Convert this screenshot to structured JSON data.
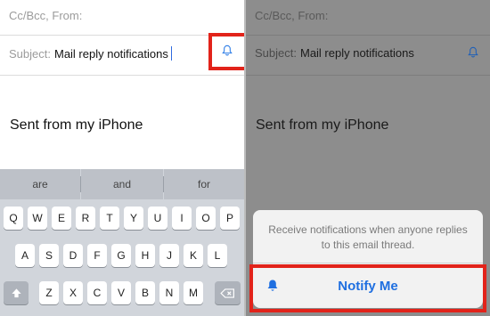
{
  "compose": {
    "cc_from_label": "Cc/Bcc, From:",
    "subject_label": "Subject:",
    "subject_value": "Mail reply notifications",
    "signature": "Sent from my iPhone"
  },
  "keyboard": {
    "suggestions": [
      "are",
      "and",
      "for"
    ],
    "row1": [
      "Q",
      "W",
      "E",
      "R",
      "T",
      "Y",
      "U",
      "I",
      "O",
      "P"
    ],
    "row2": [
      "A",
      "S",
      "D",
      "F",
      "G",
      "H",
      "J",
      "K",
      "L"
    ],
    "row3": [
      "Z",
      "X",
      "C",
      "V",
      "B",
      "N",
      "M"
    ]
  },
  "notify_sheet": {
    "message": "Receive notifications when anyone replies to this email thread.",
    "button_label": "Notify Me"
  },
  "icons": {
    "bell": "bell-icon",
    "shift": "shift-icon",
    "backspace": "backspace-icon"
  },
  "colors": {
    "highlight": "#e2231a",
    "accent": "#1f6fe0"
  }
}
